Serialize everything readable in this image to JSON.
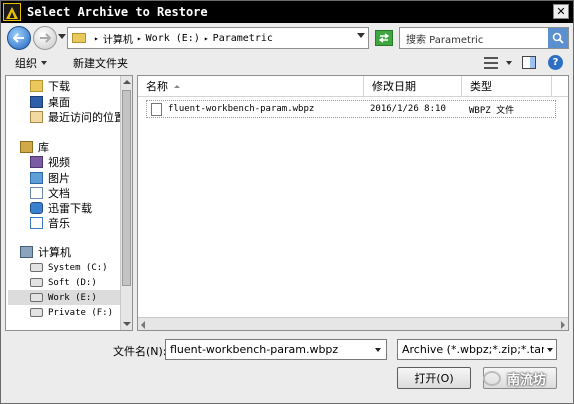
{
  "window": {
    "title": "Select Archive to Restore",
    "close_glyph": "✕"
  },
  "address": {
    "crumbs": [
      "计算机",
      "Work (E:)",
      "Parametric"
    ],
    "separator": "▸",
    "search_placeholder": "搜索 Parametric"
  },
  "toolbar": {
    "organize": "组织",
    "new_folder": "新建文件夹",
    "help": "?"
  },
  "nav": {
    "favorites": [
      {
        "label": "下载",
        "icon": "download-folder-icon"
      },
      {
        "label": "桌面",
        "icon": "desktop-icon"
      },
      {
        "label": "最近访问的位置",
        "icon": "recent-places-icon"
      }
    ],
    "libraries_label": "库",
    "libraries": [
      {
        "label": "视频",
        "icon": "video-library-icon"
      },
      {
        "label": "图片",
        "icon": "pictures-library-icon"
      },
      {
        "label": "文档",
        "icon": "documents-library-icon"
      },
      {
        "label": "迅雷下载",
        "icon": "thunder-download-icon"
      },
      {
        "label": "音乐",
        "icon": "music-library-icon"
      }
    ],
    "computer_label": "计算机",
    "drives": [
      {
        "label": "System (C:)",
        "icon": "drive-icon"
      },
      {
        "label": "Soft (D:)",
        "icon": "drive-icon"
      },
      {
        "label": "Work (E:)",
        "icon": "drive-icon",
        "selected": true
      },
      {
        "label": "Private (F:)",
        "icon": "drive-icon"
      }
    ]
  },
  "files": {
    "columns": {
      "name": "名称",
      "modified": "修改日期",
      "type": "类型"
    },
    "rows": [
      {
        "name": "fluent-workbench-param.wbpz",
        "modified": "2016/1/26 8:10",
        "type": "WBPZ 文件"
      }
    ]
  },
  "footer": {
    "filename_label": "文件名(N):",
    "filename_value": "fluent-workbench-param.wbpz",
    "filter_value": "Archive (*.wbpz;*.zip;*.tar.gz)",
    "open_label": "打开(O)",
    "watermark": "南流坊"
  }
}
